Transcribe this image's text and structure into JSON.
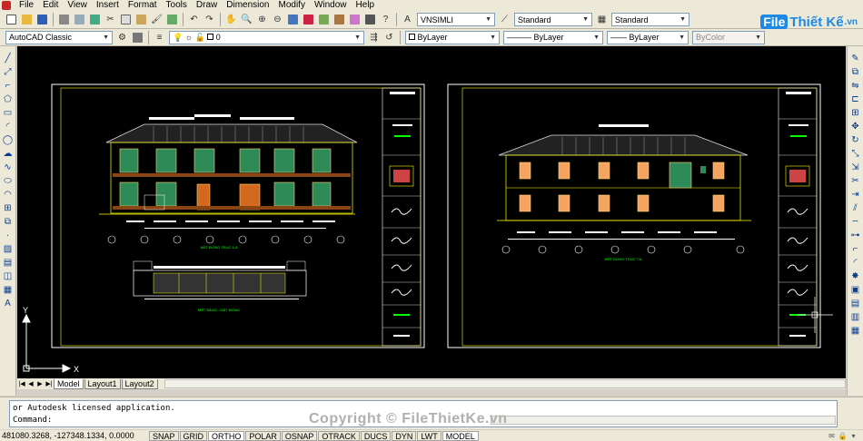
{
  "menu": {
    "items": [
      "File",
      "Edit",
      "View",
      "Insert",
      "Format",
      "Tools",
      "Draw",
      "Dimension",
      "Modify",
      "Window",
      "Help"
    ]
  },
  "toolbar1": {
    "text_style": "VNSIMLI",
    "dim_style": "Standard",
    "table_style": "Standard"
  },
  "toolbar2": {
    "workspace": "AutoCAD Classic",
    "layer": "0",
    "color": "ByLayer",
    "linetype": "ByLayer",
    "lineweight": "ByLayer",
    "plotstyle": "ByColor"
  },
  "logo": {
    "badge": "File",
    "text": "Thiết Kế",
    "domain": ".vn"
  },
  "tabs": {
    "items": [
      "Model",
      "Layout1",
      "Layout2"
    ],
    "active": "Model"
  },
  "command": {
    "history": "or Autodesk licensed application.",
    "prompt": "Command:"
  },
  "watermark": "Copyright © FileThietKe.vn",
  "status": {
    "coords": "481080.3268, -127348.1334, 0.0000",
    "toggles": [
      "SNAP",
      "GRID",
      "ORTHO",
      "POLAR",
      "OSNAP",
      "OTRACK",
      "DUCS",
      "DYN",
      "LWT",
      "MODEL"
    ],
    "on": [
      "ORTHO",
      "MODEL"
    ]
  },
  "drawing": {
    "sheet1": {
      "elevation_title": "MẶT ĐỨNG TRỤC 1-4",
      "plan_title": "MẶT BẰNG - MẶT ĐỨNG"
    },
    "sheet2": {
      "elevation_title": "MẶT ĐỨNG TRỤC 7-8"
    },
    "ucs_x": "X",
    "ucs_y": "Y"
  }
}
